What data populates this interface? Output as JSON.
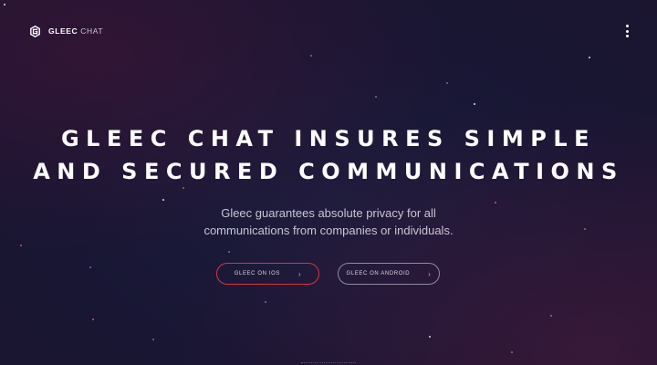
{
  "header": {
    "logo_strong": "GLEEC",
    "logo_light": "CHAT",
    "logo_icon": "gleec-logo-icon",
    "menu_icon": "vertical-dots-icon"
  },
  "hero": {
    "title_line1": "GLEEC CHAT INSURES SIMPLE",
    "title_line2": "AND SECURED COMMUNICATIONS",
    "subtitle_line1": "Gleec guarantees absolute privacy for all",
    "subtitle_line2": "communications from companies or individuals."
  },
  "buttons": {
    "ios_label": "GLEEC ON IOS",
    "android_label": "GLEEC ON ANDROID",
    "chevron": "›"
  },
  "colors": {
    "background": "#1a1835",
    "accent_red": "#d6353f",
    "button_border_neutral": "#8e8ba2",
    "text_primary": "#ffffff",
    "text_secondary": "#c8c5d6"
  }
}
